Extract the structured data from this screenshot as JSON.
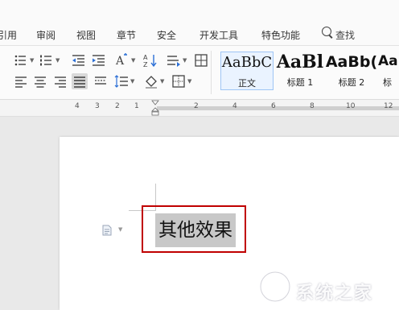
{
  "menu": {
    "items": [
      "引用",
      "审阅",
      "视图",
      "章节",
      "安全",
      "开发工具",
      "特色功能"
    ],
    "search_label": "查找"
  },
  "styles_gallery": [
    {
      "sample": "AaBbC",
      "name": "正文",
      "active": true
    },
    {
      "sample": "AaBl",
      "name": "标题 1",
      "active": false
    },
    {
      "sample": "AaBb(",
      "name": "标题 2",
      "active": false
    },
    {
      "sample": "Aa",
      "name": "标",
      "active": false
    }
  ],
  "ruler": {
    "numbers": [
      "4",
      "3",
      "2",
      "1",
      "2",
      "4",
      "6",
      "8",
      "10",
      "12"
    ]
  },
  "document": {
    "selected_text": "其他效果"
  },
  "watermark": {
    "text": "系统之家"
  },
  "colors": {
    "highlight_box": "#c00000",
    "selection": "#c8c8c8",
    "active_style": "#eaf3ff"
  }
}
